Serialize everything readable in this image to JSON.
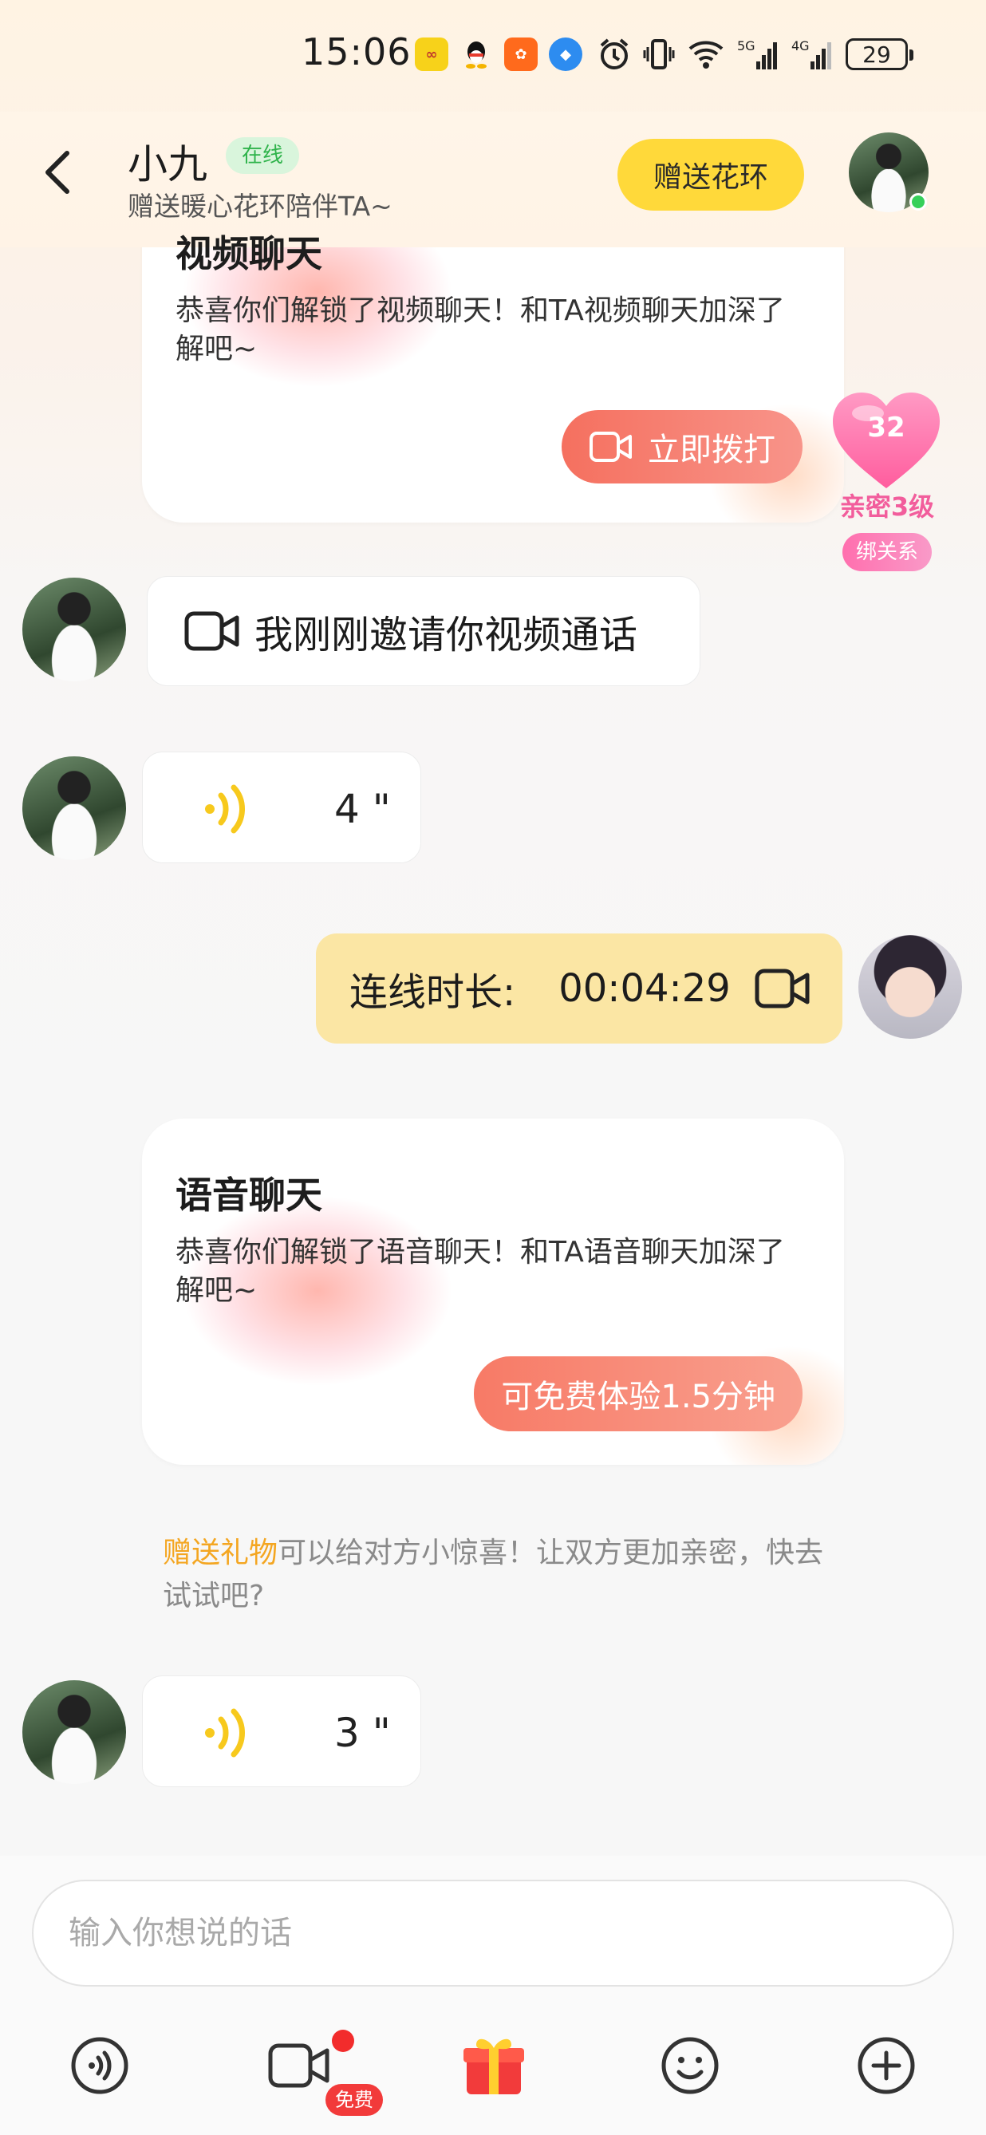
{
  "status_bar": {
    "time": "15:06",
    "app_icons": [
      "app-icon",
      "qq-icon",
      "app-icon",
      "browser-icon"
    ],
    "network_5g": "5G",
    "network_4g": "4G",
    "battery": "29"
  },
  "header": {
    "name": "小九",
    "online_badge": "在线",
    "subtitle": "赠送暖心花环陪伴TA~",
    "gift_wreath_button": "赠送花环"
  },
  "intimacy": {
    "value": "32",
    "level": "亲密3级",
    "bind_label": "绑关系",
    "color": "#f25d9c"
  },
  "video_card": {
    "title": "视频聊天",
    "description": "恭喜你们解锁了视频聊天！和TA视频聊天加深了解吧~",
    "button": "立即拨打"
  },
  "messages": {
    "video_invite": "我刚刚邀请你视频通话",
    "voice_1_duration": "4 \"",
    "call_duration_label": "连线时长:",
    "call_duration_value": "00:04:29",
    "voice_2_duration": "3 \""
  },
  "voice_card": {
    "title": "语音聊天",
    "description": "恭喜你们解锁了语音聊天！和TA语音聊天加深了解吧~",
    "button": "可免费体验1.5分钟"
  },
  "tip": {
    "highlight": "赠送礼物",
    "text": "可以给对方小惊喜！让双方更加亲密，快去试试吧?"
  },
  "input": {
    "placeholder": "输入你想说的话"
  },
  "toolbar": {
    "free_badge": "免费",
    "items": [
      "voice-icon",
      "video-icon",
      "gift-icon",
      "emoji-icon",
      "plus-icon"
    ]
  },
  "colors": {
    "accent_yellow": "#ffd93a",
    "card_button": "#f77a66",
    "call_bubble": "#fbe6a4",
    "tip_highlight": "#f4a621",
    "online_green": "#2fb34b"
  }
}
